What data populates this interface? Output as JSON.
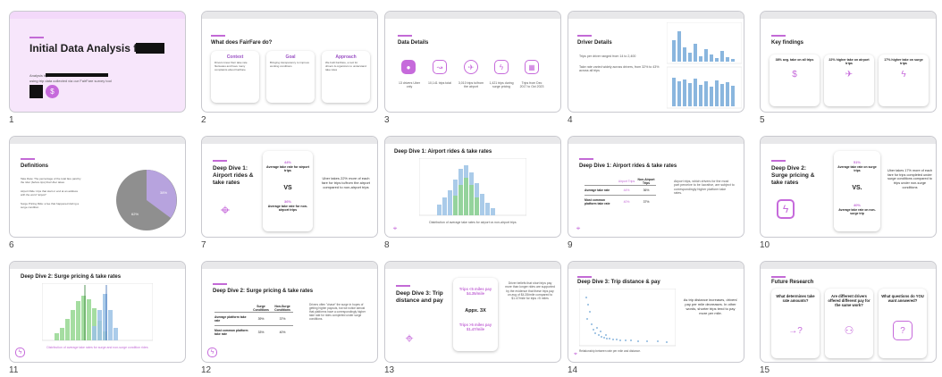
{
  "slides": [
    {
      "num": "1",
      "title": "Initial Data Analysis for",
      "sub1": "Analysis by",
      "sub2": "using trip data collected via our FairFare survey tool"
    },
    {
      "num": "2",
      "title": "What does FairFare do?",
      "cols": [
        {
          "h": "Context",
          "body": "Drivers know their take rate fluctuates and have many complaints about FairFare"
        },
        {
          "h": "Goal",
          "body": "Bringing transparency to improve working conditions"
        },
        {
          "h": "Approach",
          "body": "We built FairFare, a tool for drivers & organizers to understand take rates"
        }
      ]
    },
    {
      "num": "3",
      "title": "Data Details",
      "items": [
        "13 drivers Uber only",
        "10,141 trips total",
        "3,010 trips to/from the airport",
        "1,421 trips during surge pricing",
        "Trips from Dec 2017 to Oct 2023"
      ]
    },
    {
      "num": "4",
      "title": "Driver Details",
      "bullets": [
        "Trips per driver ranged from 14 to 2,400",
        "Take rate varied widely across drivers, from 32% to 43% across all trips"
      ]
    },
    {
      "num": "5",
      "title": "Key findings",
      "cards": [
        {
          "h": "38% avg. take on all trips"
        },
        {
          "h": "22% higher take on airport trips"
        },
        {
          "h": "17% higher take on surge trips"
        }
      ]
    },
    {
      "num": "6",
      "title": "Definitions",
      "terms": [
        "Take Rate: The percentage of the total fare paid by the rider (before tips) that Uber takes",
        "Airport Ride: trips that start or end at an address with the word \"airport\"",
        "Surge Pricing Ride: a fee that happened during a surge condition"
      ],
      "pie": [
        {
          "label": "Uber takes",
          "value": "38%"
        },
        {
          "label": "Driver keeps",
          "value": "62%"
        }
      ]
    },
    {
      "num": "7",
      "title": "Deep Dive 1: Airport rides & take rates",
      "top": "44%",
      "top_lbl": "Average take rate for airport trips",
      "vs": "VS",
      "bot": "36%",
      "bot_lbl": "Average take rate for non-airport trips",
      "note": "Uber takes 22% more of each fare for trips to/from the airport compared to non-airport trips"
    },
    {
      "num": "8",
      "title": "Deep Dive 1: Airport rides & take rates",
      "caption": "Distribution of average take rates for airport vs non-airport trips"
    },
    {
      "num": "9",
      "title": "Deep Dive 1: Airport rides & take rates",
      "headers": [
        "Airport Trips",
        "Non-Airport Trips"
      ],
      "rows": [
        [
          "Average take rate",
          "44%",
          "36%"
        ],
        [
          "Most common platform take rate",
          "40%",
          "37%"
        ]
      ],
      "note": "Airport trips, which drivers for the most part perceive to be lucrative, are subject to correspondingly higher platform take rates."
    },
    {
      "num": "10",
      "title": "Deep Dive 2: Surge pricing & take rates",
      "top": "51%",
      "top_lbl": "Average take rate on surge trips",
      "vs": "VS.",
      "bot": "40%",
      "bot_lbl": "Average take rate on non-surge trip",
      "note": "Uber takes 17% more of each fare for trips completed under surge conditions compared to trips under non-surge conditions"
    },
    {
      "num": "11",
      "title": "Deep Dive 2: Surge pricing & take rates",
      "caption": "Distribution of average take rates for surge and non-surge condition rides"
    },
    {
      "num": "12",
      "title": "Deep Dive 2: Surge pricing & take rates",
      "headers": [
        "Surge Conditions",
        "Non-Surge Conditions"
      ],
      "rows": [
        [
          "Average platform take rate",
          "39%",
          "37%"
        ],
        [
          "Most common platform take rate",
          "33%",
          "40%"
        ]
      ],
      "note": "Drivers often \"chase\" the surge in hopes of getting higher payouts, but we notice almost that platforms have a correspondingly higher take rate for rides completed under surge conditions."
    },
    {
      "num": "13",
      "title": "Deep Dive 3: Trip distance and pay",
      "c1": "Trips <5 miles pay $4.35/mile",
      "c2": "Appx. 3X",
      "c3": "Trips >5 miles pay $1.47/mile",
      "note": "Driver beliefs that short trips pay more than longer rides are supported by the evidence that these trips pay on avg of $4.35/mile compared to $1.47/mile for trips >5 miles"
    },
    {
      "num": "14",
      "title": "Deep Dive 3: Trip distance & pay",
      "note": "As trip distance increases, drivers' pay per mile decreases. In other words, shorter trips tend to pay more per mile.",
      "caption": "Relationship between rate per mile and distance."
    },
    {
      "num": "15",
      "title": "Future Research",
      "q": [
        "What determines take rate amounts?",
        "Are different drivers offered different pay for the same work?",
        "What questions do YOU want answered?"
      ]
    }
  ],
  "colors": {
    "accent": "#c36ad6",
    "green": "#8fd58a",
    "blue": "#9cc3e6"
  }
}
